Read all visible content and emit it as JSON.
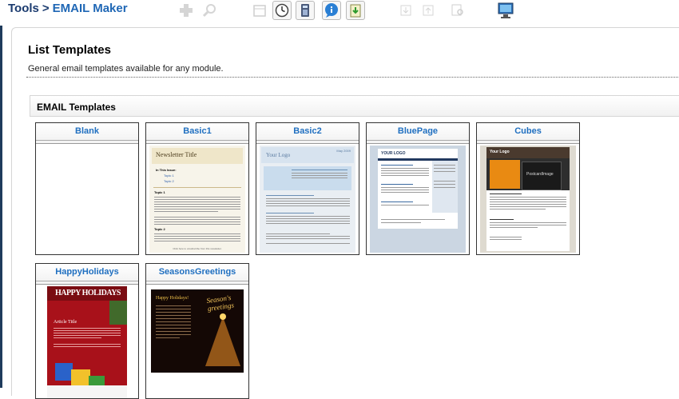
{
  "breadcrumb": {
    "parent": "Tools",
    "separator": ">",
    "current": "EMAIL Maker"
  },
  "toolbar": {
    "icons": [
      "add-icon",
      "search-icon",
      "calendar-icon",
      "clock-icon",
      "calculator-icon",
      "chat-icon",
      "import-icon",
      "download-icon",
      "upload-icon",
      "find-icon",
      "monitor-icon"
    ]
  },
  "page": {
    "title": "List Templates",
    "description": "General email templates available for any module."
  },
  "section": {
    "title": "EMAIL Templates"
  },
  "templates": [
    {
      "name": "Blank"
    },
    {
      "name": "Basic1",
      "thumb": {
        "title": "Newsletter Title",
        "subtitle": "In This Issue:",
        "links": [
          "Topic 1",
          "Topic 2"
        ],
        "topic1": "Topic 1",
        "topic2": "Topic 2",
        "footer": "Click here to unsubscribe from this newsletter."
      }
    },
    {
      "name": "Basic2",
      "thumb": {
        "logo": "Your Logo",
        "date": "May 2009"
      }
    },
    {
      "name": "BluePage",
      "thumb": {
        "logo": "YOUR LOGO"
      }
    },
    {
      "name": "Cubes",
      "thumb": {
        "logo": "Your Logo",
        "image_label": "PostcardImage"
      }
    },
    {
      "name": "HappyHolidays",
      "thumb": {
        "banner": "HAPPY HOLIDAYS",
        "article": "Article Title"
      }
    },
    {
      "name": "SeasonsGreetings",
      "thumb": {
        "greeting": "Happy Holidays!",
        "script": "Season's greetings"
      }
    }
  ],
  "colors": {
    "link": "#1f6fc0",
    "breadcrumb": "#1b3b6f",
    "accent_red": "#b5121b"
  }
}
